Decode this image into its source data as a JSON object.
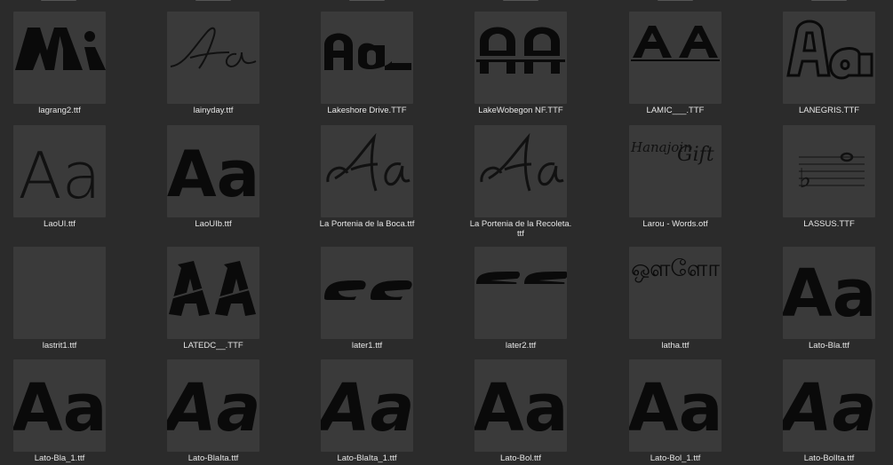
{
  "files": [
    {
      "name": "lagrang2.ttf",
      "icon": "lagrang2-preview-icon"
    },
    {
      "name": "lainyday.ttf",
      "icon": "lainyday-preview-icon"
    },
    {
      "name": "Lakeshore Drive.TTF",
      "icon": "lakeshore-drive-preview-icon"
    },
    {
      "name": "LakeWobegon NF.TTF",
      "icon": "lakewobegon-preview-icon"
    },
    {
      "name": "LAMIC___.TTF",
      "icon": "lamic-preview-icon"
    },
    {
      "name": "LANEGRIS.TTF",
      "icon": "lanegris-preview-icon"
    },
    {
      "name": "LaoUI.ttf",
      "icon": "laoui-preview-icon"
    },
    {
      "name": "LaoUIb.ttf",
      "icon": "laouib-preview-icon"
    },
    {
      "name": "La Portenia de la Boca.ttf",
      "icon": "la-portenia-boca-preview-icon"
    },
    {
      "name": "La Portenia de la Recoleta.\nttf",
      "icon": "la-portenia-recoleta-preview-icon"
    },
    {
      "name": "Larou - Words.otf",
      "icon": "larou-words-preview-icon",
      "preview_text": [
        "Hanajoin",
        "Gift"
      ]
    },
    {
      "name": "LASSUS.TTF",
      "icon": "lassus-preview-icon"
    },
    {
      "name": "lastrit1.ttf",
      "icon": "lastrit1-preview-icon"
    },
    {
      "name": "LATEDC__.TTF",
      "icon": "latedc-preview-icon"
    },
    {
      "name": "later1.ttf",
      "icon": "later1-preview-icon"
    },
    {
      "name": "later2.ttf",
      "icon": "later2-preview-icon"
    },
    {
      "name": "latha.ttf",
      "icon": "latha-preview-icon",
      "preview_text": "ஔளோ"
    },
    {
      "name": "Lato-Bla.ttf",
      "icon": "lato-bla-preview-icon"
    },
    {
      "name": "Lato-Bla_1.ttf",
      "icon": "lato-bla-1-preview-icon"
    },
    {
      "name": "Lato-BlaIta.ttf",
      "icon": "lato-blaita-preview-icon"
    },
    {
      "name": "Lato-BlaIta_1.ttf",
      "icon": "lato-blaita-1-preview-icon"
    },
    {
      "name": "Lato-Bol.ttf",
      "icon": "lato-bol-preview-icon"
    },
    {
      "name": "Lato-Bol_1.ttf",
      "icon": "lato-bol-1-preview-icon"
    },
    {
      "name": "Lato-BolIta.ttf",
      "icon": "lato-bolita-preview-icon"
    }
  ],
  "preview_glyph": "Aa",
  "preview_caps": "AA",
  "colors": {
    "background": "#2b2b2b",
    "thumbnail": "#3a3a3a",
    "label": "#e6e6e6",
    "glyph": "#0d0d0d"
  }
}
